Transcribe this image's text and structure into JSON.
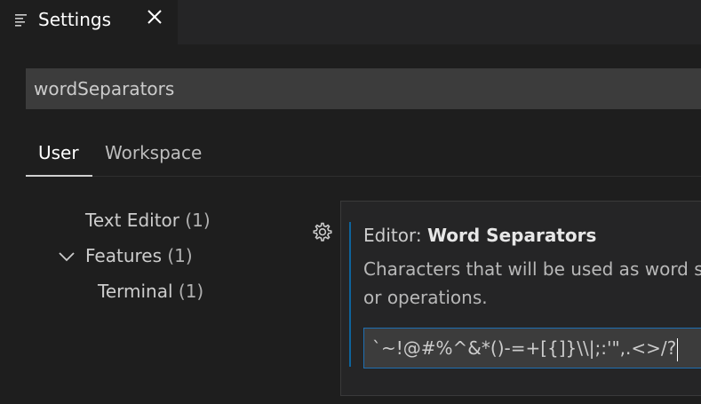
{
  "tab": {
    "title": "Settings",
    "icon": "settings-list-icon",
    "close_icon": "close-icon"
  },
  "search": {
    "value": "wordSeparators"
  },
  "scopes": {
    "user": "User",
    "workspace": "Workspace",
    "active": "User"
  },
  "toc": {
    "items": [
      {
        "label": "Text Editor",
        "count": "(1)"
      },
      {
        "label": "Features",
        "count": "(1)",
        "expanded": true
      },
      {
        "label": "Terminal",
        "count": "(1)"
      }
    ]
  },
  "setting": {
    "category": "Editor: ",
    "name": "Word Separators",
    "description_line1": "Characters that will be used as word s",
    "description_line2": "or operations.",
    "value": "`~!@#%^&*()-=+[{]}\\\\|;:'\",.<>/?",
    "gear_icon": "gear-icon"
  },
  "colors": {
    "background": "#1e1e1e",
    "tabbar": "#252526",
    "input_bg": "#3c3c3c",
    "focus": "#0e639c"
  }
}
